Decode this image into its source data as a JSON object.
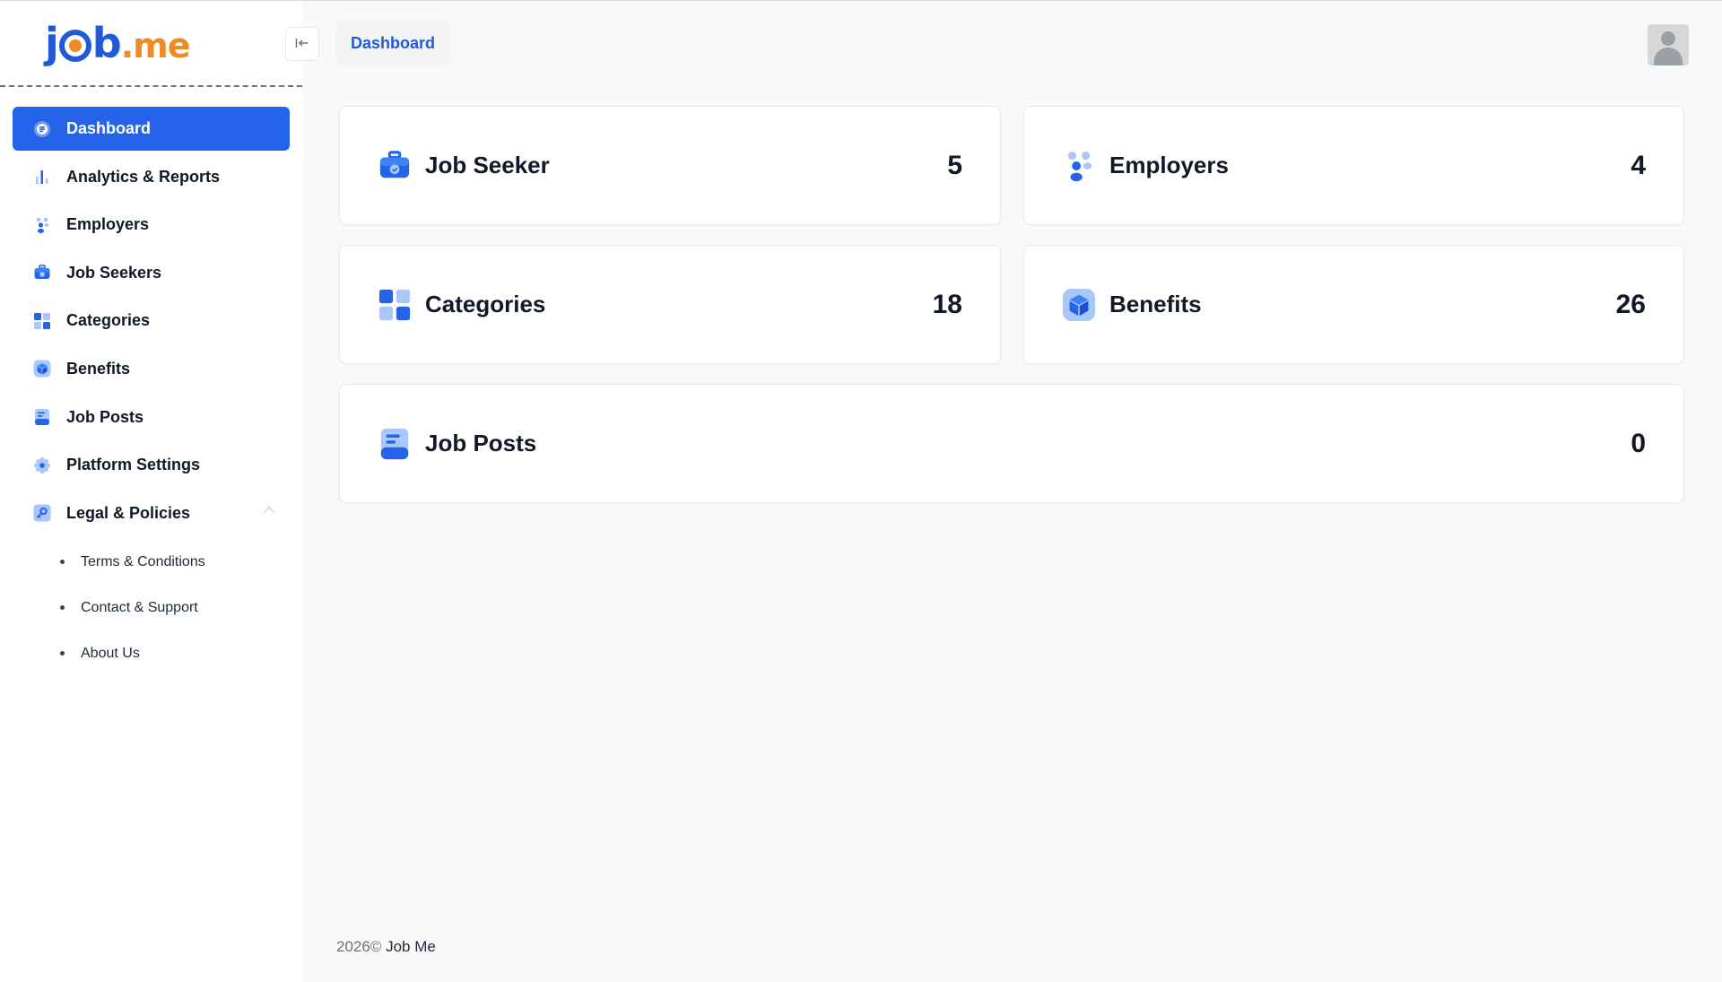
{
  "brand": {
    "logo_j": "j",
    "logo_o": "o",
    "logo_b": "b",
    "logo_suffix": ".me"
  },
  "topbar": {
    "breadcrumb": "Dashboard",
    "collapse_icon": "arrow-left-to-line-icon"
  },
  "sidebar": {
    "items": [
      {
        "label": "Dashboard",
        "icon": "dashboard-icon",
        "active": true
      },
      {
        "label": "Analytics & Reports",
        "icon": "bar-chart-icon"
      },
      {
        "label": "Employers",
        "icon": "people-icon"
      },
      {
        "label": "Job Seekers",
        "icon": "briefcase-icon"
      },
      {
        "label": "Categories",
        "icon": "grid-icon"
      },
      {
        "label": "Benefits",
        "icon": "cube-icon"
      },
      {
        "label": "Job Posts",
        "icon": "document-icon"
      },
      {
        "label": "Platform Settings",
        "icon": "gear-icon"
      },
      {
        "label": "Legal & Policies",
        "icon": "key-icon",
        "expanded": true
      }
    ],
    "subitems": [
      {
        "label": "Terms & Conditions"
      },
      {
        "label": "Contact & Support"
      },
      {
        "label": "About Us"
      }
    ]
  },
  "cards": [
    {
      "label": "Job Seeker",
      "value": "5",
      "icon": "briefcase-icon"
    },
    {
      "label": "Employers",
      "value": "4",
      "icon": "people-icon"
    },
    {
      "label": "Categories",
      "value": "18",
      "icon": "grid-icon"
    },
    {
      "label": "Benefits",
      "value": "26",
      "icon": "cube-icon"
    },
    {
      "label": "Job Posts",
      "value": "0",
      "icon": "document-icon"
    }
  ],
  "footer": {
    "year": "2026©",
    "brand": "Job Me"
  },
  "colors": {
    "primary": "#2563eb",
    "brand_blue": "#1f5bd9",
    "brand_orange": "#f08a24",
    "icon_light": "#a9c7fb"
  }
}
